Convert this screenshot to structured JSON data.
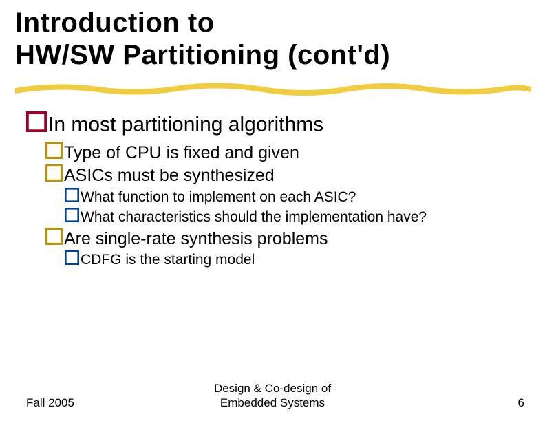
{
  "title": "Introduction to\nHW/SW Partitioning (cont'd)",
  "bullets": {
    "l1_1": "In most partitioning algorithms",
    "l2_1": "Type of CPU is fixed and given",
    "l2_2": "ASICs must be synthesized",
    "l3_1": "What function to implement on each ASIC?",
    "l3_2": "What characteristics should the implementation have?",
    "l2_3": "Are single-rate synthesis problems",
    "l3_3": "CDFG is the starting model"
  },
  "footer": {
    "left": "Fall 2005",
    "center": "Design & Co-design of\nEmbedded Systems",
    "right": "6"
  },
  "colors": {
    "bullet_z": "#a00028",
    "bullet_y": "#b89400",
    "bullet_x": "#0040a0",
    "underline": "#f2cc3f"
  }
}
